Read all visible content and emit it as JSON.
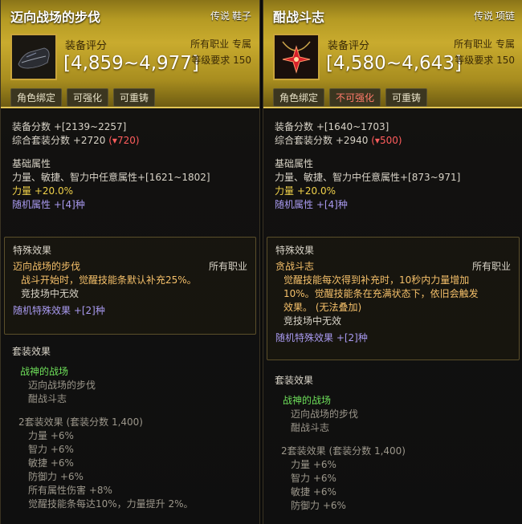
{
  "left": {
    "title": "迈向战场的步伐",
    "rarity": "传说",
    "slot": "鞋子",
    "score_label": "装备评分",
    "score_range": "[4,859~4,977]",
    "class_tag": "所有职业 专属",
    "level_tag": "等级要求 150",
    "tags": [
      "角色绑定",
      "可强化",
      "可重铸"
    ],
    "equip_score": "装备分数 +[2139~2257]",
    "set_score": "综合套装分数 +2720",
    "set_score_down": "(▾720)",
    "base_title": "基础属性",
    "base_line": "力量、敏捷、智力中任意属性+[1621~1802]",
    "str_line": "力量 +20.0%",
    "random_line": "随机属性 +[4]种",
    "special_title": "特殊效果",
    "special_name": "迈向战场的步伐",
    "special_class": "所有职业",
    "special_desc": [
      "战斗开始时，觉醒技能条默认补充25%。"
    ],
    "special_note": "竞技场中无效",
    "random_special": "随机特殊效果 +[2]种",
    "set_title": "套装效果",
    "set_name": "战神的战场",
    "set_items": [
      "迈向战场的步伐",
      "酣战斗志"
    ],
    "set_bonus_title": "2套装效果 (套装分数 1,400)",
    "set_bonus": [
      "力量 +6%",
      "智力 +6%",
      "敏捷 +6%",
      "防御力 +6%",
      "所有属性伤害 +8%",
      "觉醒技能条每达10%，力量提升 2%。"
    ]
  },
  "right": {
    "title": "酣战斗志",
    "rarity": "传说",
    "slot": "项链",
    "score_label": "装备评分",
    "score_range": "[4,580~4,643]",
    "class_tag": "所有职业 专属",
    "level_tag": "等级要求 150",
    "tags": [
      "角色绑定",
      "不可强化",
      "可重铸"
    ],
    "equip_score": "装备分数 +[1640~1703]",
    "set_score": "综合套装分数 +2940",
    "set_score_down": "(▾500)",
    "base_title": "基础属性",
    "base_line": "力量、敏捷、智力中任意属性+[873~971]",
    "str_line": "力量 +20.0%",
    "random_line": "随机属性 +[4]种",
    "special_title": "特殊效果",
    "special_name": "贪战斗志",
    "special_class": "所有职业",
    "special_desc": [
      "觉醒技能每次得到补充时，10秒内力量增加",
      "10%。觉醒技能条在充满状态下，依旧会触发",
      "效果。 (无法叠加)"
    ],
    "special_note": "竞技场中无效",
    "random_special": "随机特殊效果 +[2]种",
    "set_title": "套装效果",
    "set_name": "战神的战场",
    "set_items": [
      "迈向战场的步伐",
      "酣战斗志"
    ],
    "set_bonus_title": "2套装效果 (套装分数 1,400)",
    "set_bonus": [
      "力量 +6%",
      "智力 +6%",
      "敏捷 +6%",
      "防御力 +6%"
    ]
  }
}
